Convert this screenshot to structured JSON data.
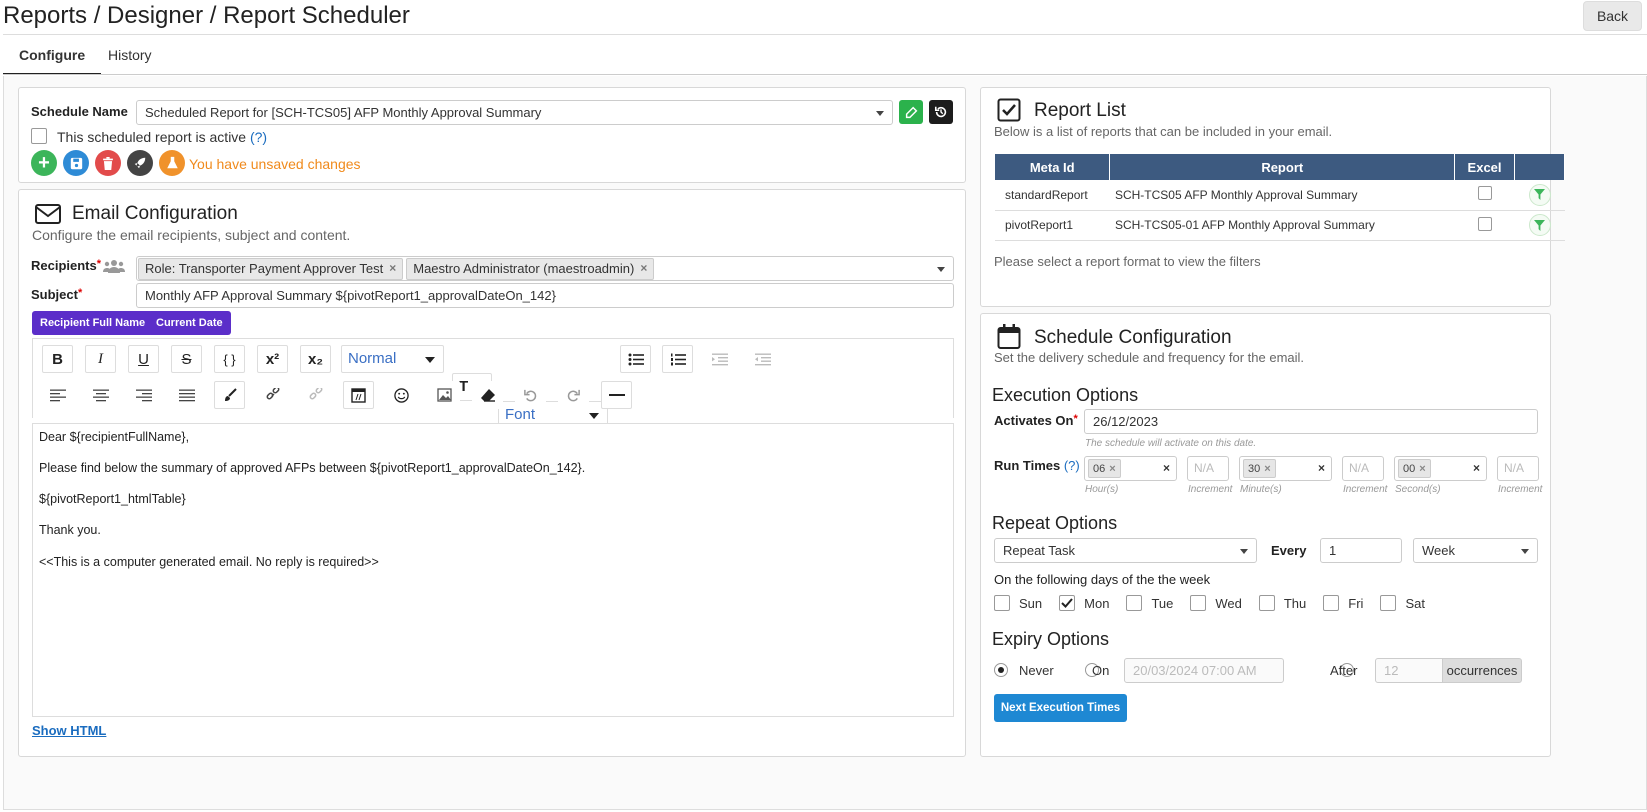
{
  "header": {
    "title": "Reports / Designer / Report Scheduler",
    "back_label": "Back"
  },
  "tabs": [
    {
      "label": "Configure"
    },
    {
      "label": "History"
    }
  ],
  "schedule": {
    "name_label": "Schedule Name",
    "name_value": "Scheduled Report for [SCH-TCS05] AFP Monthly Approval Summary",
    "active_label": "This scheduled report is active",
    "help": "(?)",
    "unsaved": "You have unsaved changes"
  },
  "email": {
    "title": "Email Configuration",
    "subtitle": "Configure the email recipients, subject and content.",
    "recipients_label": "Recipients",
    "required": "*",
    "recipients": [
      {
        "label": "Role: Transporter Payment Approver Test",
        "remove": "×"
      },
      {
        "label": "Maestro Administrator (maestroadmin)",
        "remove": "×"
      }
    ],
    "subject_label": "Subject",
    "subject_value": "Monthly AFP Approval Summary ${pivotReport1_approvalDateOn_142}",
    "placeholders": [
      "Recipient Full Name",
      "Current Date"
    ],
    "toolbar": {
      "bold": "B",
      "italic": "I",
      "underline": "U",
      "strike": "S",
      "code": "{ }",
      "superscript": "x²",
      "subscript": "x₂",
      "format": "Normal",
      "font_size": "T",
      "font": "Font"
    },
    "body_lines": [
      "Dear ${recipientFullName},",
      "Please find below the summary of approved AFPs between ${pivotReport1_approvalDateOn_142}.",
      "${pivotReport1_htmlTable}",
      "Thank you.",
      "<<This is a computer generated email. No reply is required>>"
    ],
    "show_html": "Show HTML"
  },
  "report_list": {
    "title": "Report List",
    "subtitle": "Below is a list of reports that can be included in your email.",
    "columns": [
      "Meta Id",
      "Report",
      "Excel"
    ],
    "rows": [
      {
        "meta_id": "standardReport",
        "report": "SCH-TCS05 AFP Monthly Approval Summary"
      },
      {
        "meta_id": "pivotReport1",
        "report": "SCH-TCS05-01 AFP Monthly Approval Summary"
      }
    ],
    "note": "Please select a report format to view the filters"
  },
  "schedule_config": {
    "title": "Schedule Configuration",
    "subtitle": "Set the delivery schedule and frequency for the email.",
    "execution": {
      "heading": "Execution Options",
      "activates_label": "Activates On",
      "activates_value": "26/12/2023",
      "activates_hint": "The schedule will activate on this date.",
      "run_times_label": "Run Times",
      "run_times_help": "(?)",
      "hour": "06",
      "minute": "30",
      "second": "00",
      "na": "N/A",
      "hour_hint": "Hour(s)",
      "minute_hint": "Minute(s)",
      "second_hint": "Second(s)",
      "increment_hint": "Increment"
    },
    "repeat": {
      "heading": "Repeat Options",
      "mode": "Repeat Task",
      "every_label": "Every",
      "every_value": "1",
      "unit": "Week",
      "days_label": "On the following days of the the week",
      "days": [
        {
          "label": "Sun",
          "checked": false
        },
        {
          "label": "Mon",
          "checked": true
        },
        {
          "label": "Tue",
          "checked": false
        },
        {
          "label": "Wed",
          "checked": false
        },
        {
          "label": "Thu",
          "checked": false
        },
        {
          "label": "Fri",
          "checked": false
        },
        {
          "label": "Sat",
          "checked": false
        }
      ]
    },
    "expiry": {
      "heading": "Expiry Options",
      "never": "Never",
      "on": "On",
      "on_placeholder": "20/03/2024 07:00 AM",
      "after": "After",
      "after_placeholder": "12",
      "occurrences": "occurrences",
      "selected": "never"
    },
    "next_button": "Next Execution Times"
  },
  "colors": {
    "green": "#3cb55a",
    "blue": "#2e8bd6",
    "red": "#e24b4b",
    "orange": "#f0922b",
    "purple": "#5b2ec9",
    "table_header": "#3d5a80",
    "unsaved": "#f08a1c"
  }
}
